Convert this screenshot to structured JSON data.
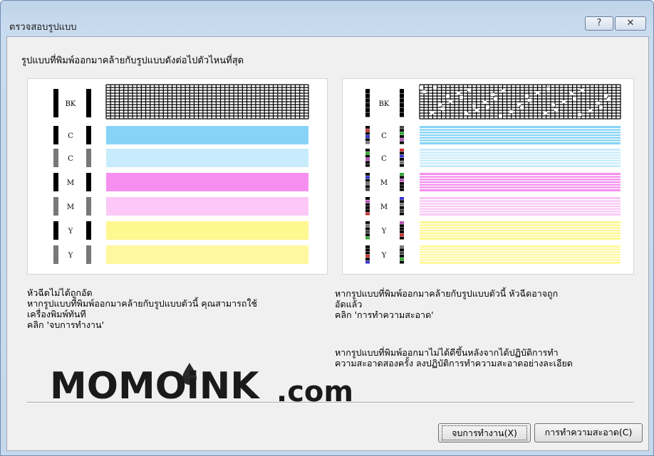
{
  "window": {
    "title": "ตรวจสอบรูปแบบ",
    "help_label": "?",
    "close_label": "✕"
  },
  "prompt": "รูปแบบที่พิมพ์ออกมาคล้ายกับรูปแบบดังต่อไปตัวไหนที่สุด",
  "pattern_left": {
    "labels": [
      "BK",
      "C",
      "C",
      "M",
      "M",
      "Y",
      "Y"
    ],
    "colors": [
      "#000000",
      "#87d3f8",
      "#c9ecfc",
      "#f78ff0",
      "#fbc8f7",
      "#fff78f",
      "#fff89e"
    ],
    "marker_colors": [
      "#000000",
      "#000000",
      "#777777",
      "#000000",
      "#777777",
      "#000000",
      "#777777"
    ]
  },
  "pattern_right": {
    "labels": [
      "BK",
      "C",
      "C",
      "M",
      "M",
      "Y",
      "Y"
    ],
    "colors": [
      "#000000",
      "#87d3f8",
      "#c9ecfc",
      "#f78ff0",
      "#fbc8f7",
      "#fff78f",
      "#fff89e"
    ]
  },
  "left_description": "หัวฉีดไม่ได้ถูกอัด\nหากรูปแบบที่พิมพ์ออกมาคล้ายกับรูปแบบตัวนี้ คุณสามารถใช้\nเครื่องพิมพ์ทันที\nคลิก 'จบการทำงาน'",
  "right_description": "หากรูปแบบที่พิมพ์ออกมาคล้ายกับรูปแบบตัวนี้ หัวฉีดอาจถูก\nอัดแล้ว\nคลิก 'การทำความสะอาด'",
  "right_description_2": "หากรูปแบบที่พิมพ์ออกมาไม่ได้ดีขึ้นหลังจากได้ปฏิบัติการทำ\nความสะอาดสองครั้ง ลงปฏิบัติการทำความสะอาดอย่างละเอียด",
  "watermark": {
    "text_main": "MOMOiNK",
    "text_suffix": ".com",
    "color": "#1a1a1a"
  },
  "buttons": {
    "end_label": "จบการทำงาน(X)",
    "clean_label": "การทำความสะอาด(C)"
  }
}
